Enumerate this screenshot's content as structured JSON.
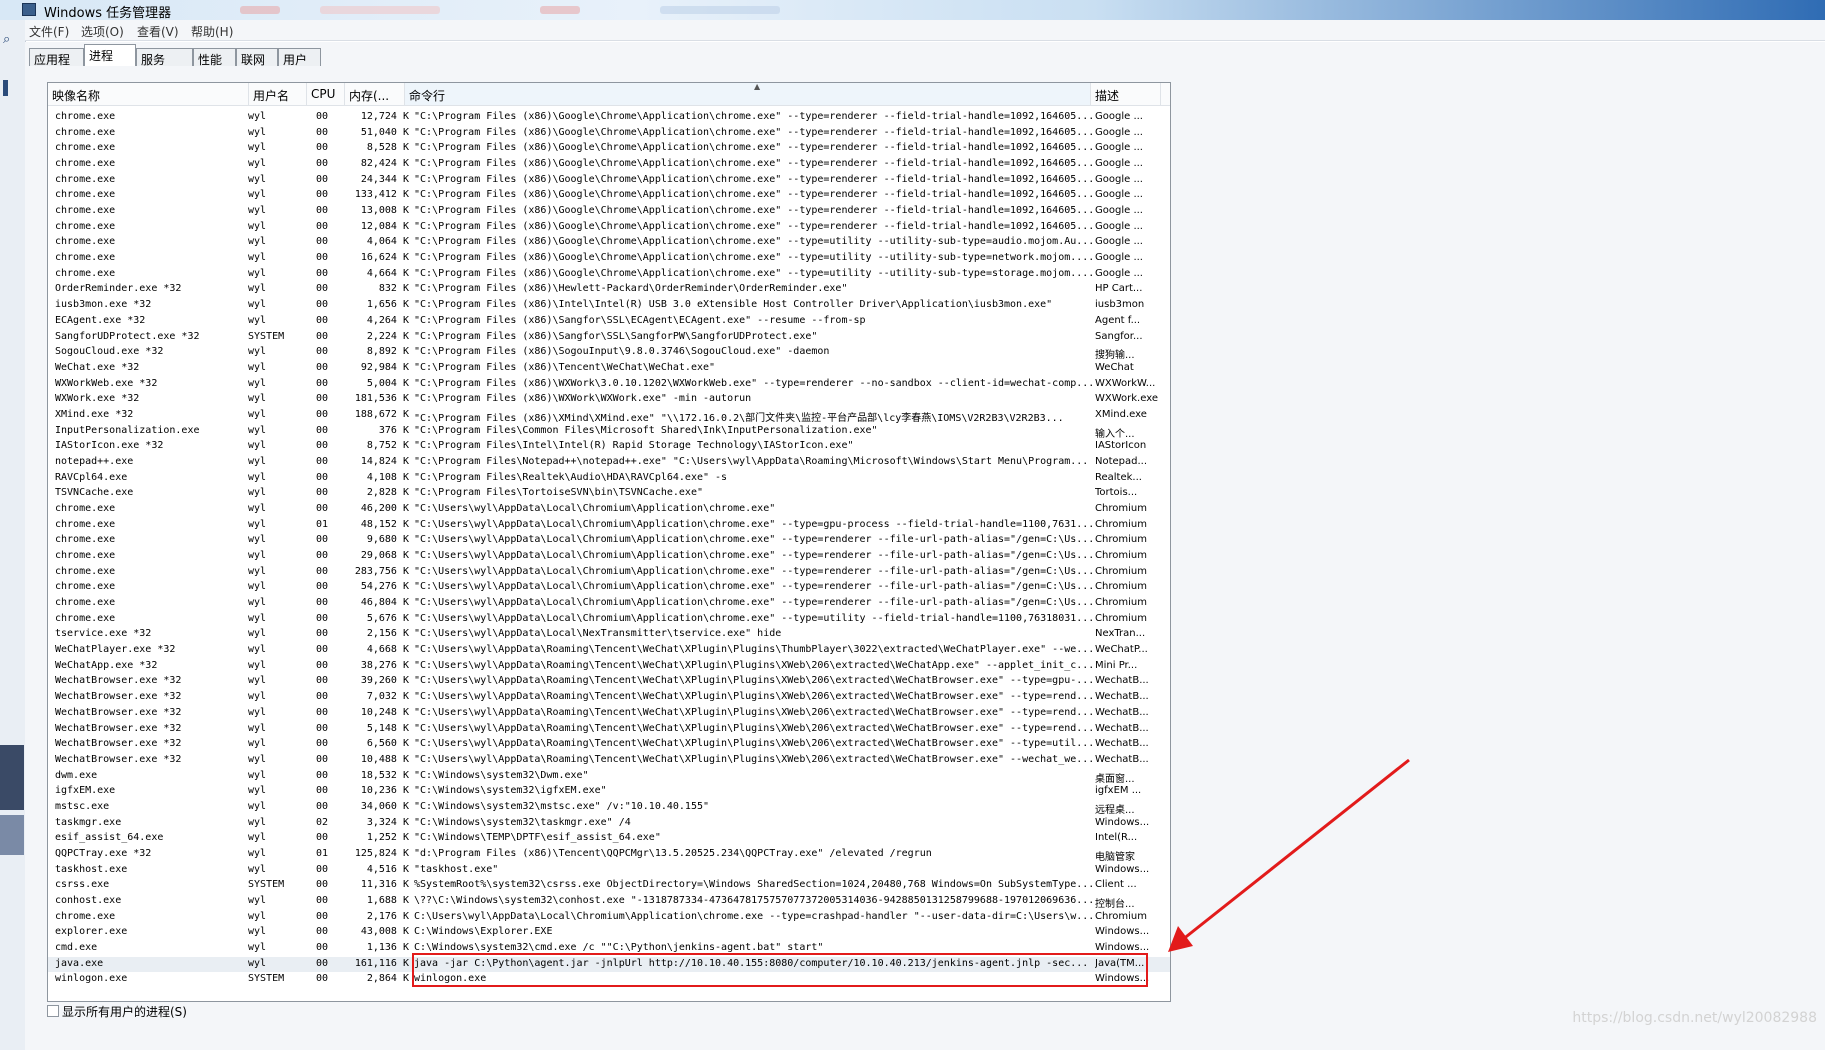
{
  "window": {
    "title": "Windows 任务管理器"
  },
  "menu": [
    {
      "label": "文件(F)"
    },
    {
      "label": "选项(O)"
    },
    {
      "label": "查看(V)"
    },
    {
      "label": "帮助(H)"
    }
  ],
  "tabs": [
    {
      "label": "应用程序"
    },
    {
      "label": "进程"
    },
    {
      "label": "服务"
    },
    {
      "label": "性能"
    },
    {
      "label": "联网"
    },
    {
      "label": "用户"
    }
  ],
  "active_tab": "进程",
  "columns": {
    "name": "映像名称",
    "user": "用户名",
    "cpu": "CPU",
    "mem": "内存(...",
    "cmd": "命令行",
    "desc": "描述"
  },
  "rows": [
    [
      "chrome.exe",
      "wyl",
      "00",
      "12,724 K",
      "\"C:\\Program Files (x86)\\Google\\Chrome\\Application\\chrome.exe\" --type=renderer --field-trial-handle=1092,164605...",
      "Google ..."
    ],
    [
      "chrome.exe",
      "wyl",
      "00",
      "51,040 K",
      "\"C:\\Program Files (x86)\\Google\\Chrome\\Application\\chrome.exe\" --type=renderer --field-trial-handle=1092,164605...",
      "Google ..."
    ],
    [
      "chrome.exe",
      "wyl",
      "00",
      "8,528 K",
      "\"C:\\Program Files (x86)\\Google\\Chrome\\Application\\chrome.exe\" --type=renderer --field-trial-handle=1092,164605...",
      "Google ..."
    ],
    [
      "chrome.exe",
      "wyl",
      "00",
      "82,424 K",
      "\"C:\\Program Files (x86)\\Google\\Chrome\\Application\\chrome.exe\" --type=renderer --field-trial-handle=1092,164605...",
      "Google ..."
    ],
    [
      "chrome.exe",
      "wyl",
      "00",
      "24,344 K",
      "\"C:\\Program Files (x86)\\Google\\Chrome\\Application\\chrome.exe\" --type=renderer --field-trial-handle=1092,164605...",
      "Google ..."
    ],
    [
      "chrome.exe",
      "wyl",
      "00",
      "133,412 K",
      "\"C:\\Program Files (x86)\\Google\\Chrome\\Application\\chrome.exe\" --type=renderer --field-trial-handle=1092,164605...",
      "Google ..."
    ],
    [
      "chrome.exe",
      "wyl",
      "00",
      "13,008 K",
      "\"C:\\Program Files (x86)\\Google\\Chrome\\Application\\chrome.exe\" --type=renderer --field-trial-handle=1092,164605...",
      "Google ..."
    ],
    [
      "chrome.exe",
      "wyl",
      "00",
      "12,084 K",
      "\"C:\\Program Files (x86)\\Google\\Chrome\\Application\\chrome.exe\" --type=renderer --field-trial-handle=1092,164605...",
      "Google ..."
    ],
    [
      "chrome.exe",
      "wyl",
      "00",
      "4,064 K",
      "\"C:\\Program Files (x86)\\Google\\Chrome\\Application\\chrome.exe\" --type=utility --utility-sub-type=audio.mojom.Au...",
      "Google ..."
    ],
    [
      "chrome.exe",
      "wyl",
      "00",
      "16,624 K",
      "\"C:\\Program Files (x86)\\Google\\Chrome\\Application\\chrome.exe\" --type=utility --utility-sub-type=network.mojom....",
      "Google ..."
    ],
    [
      "chrome.exe",
      "wyl",
      "00",
      "4,664 K",
      "\"C:\\Program Files (x86)\\Google\\Chrome\\Application\\chrome.exe\" --type=utility --utility-sub-type=storage.mojom....",
      "Google ..."
    ],
    [
      "OrderReminder.exe *32",
      "wyl",
      "00",
      "832 K",
      "\"C:\\Program Files (x86)\\Hewlett-Packard\\OrderReminder\\OrderReminder.exe\"",
      "HP Cart..."
    ],
    [
      "iusb3mon.exe *32",
      "wyl",
      "00",
      "1,656 K",
      "\"C:\\Program Files (x86)\\Intel\\Intel(R) USB 3.0 eXtensible Host Controller Driver\\Application\\iusb3mon.exe\"",
      "iusb3mon"
    ],
    [
      "ECAgent.exe *32",
      "wyl",
      "00",
      "4,264 K",
      "\"C:\\Program Files (x86)\\Sangfor\\SSL\\ECAgent\\ECAgent.exe\" --resume --from-sp",
      "Agent f..."
    ],
    [
      "SangforUDProtect.exe *32",
      "SYSTEM",
      "00",
      "2,224 K",
      "\"C:\\Program Files (x86)\\Sangfor\\SSL\\SangforPW\\SangforUDProtect.exe\"",
      "Sangfor..."
    ],
    [
      "SogouCloud.exe *32",
      "wyl",
      "00",
      "8,892 K",
      "\"C:\\Program Files (x86)\\SogouInput\\9.8.0.3746\\SogouCloud.exe\" -daemon",
      "搜狗输..."
    ],
    [
      "WeChat.exe *32",
      "wyl",
      "00",
      "92,984 K",
      "\"C:\\Program Files (x86)\\Tencent\\WeChat\\WeChat.exe\"",
      "WeChat"
    ],
    [
      "WXWorkWeb.exe *32",
      "wyl",
      "00",
      "5,004 K",
      "\"C:\\Program Files (x86)\\WXWork\\3.0.10.1202\\WXWorkWeb.exe\" --type=renderer --no-sandbox --client-id=wechat-comp...",
      "WXWorkW..."
    ],
    [
      "WXWork.exe *32",
      "wyl",
      "00",
      "181,536 K",
      "\"C:\\Program Files (x86)\\WXWork\\WXWork.exe\" -min -autorun",
      "WXWork.exe"
    ],
    [
      "XMind.exe *32",
      "wyl",
      "00",
      "188,672 K",
      "\"C:\\Program Files (x86)\\XMind\\XMind.exe\" \"\\\\172.16.0.2\\部门文件夹\\监控-平台产品部\\lcy李春燕\\IOMS\\V2R2B3\\V2R2B3...",
      "XMind.exe"
    ],
    [
      "InputPersonalization.exe",
      "wyl",
      "00",
      "376 K",
      "\"C:\\Program Files\\Common Files\\Microsoft Shared\\Ink\\InputPersonalization.exe\"",
      "输入个..."
    ],
    [
      "IAStorIcon.exe *32",
      "wyl",
      "00",
      "8,752 K",
      "\"C:\\Program Files\\Intel\\Intel(R) Rapid Storage Technology\\IAStorIcon.exe\"",
      "IAStorIcon"
    ],
    [
      "notepad++.exe",
      "wyl",
      "00",
      "14,824 K",
      "\"C:\\Program Files\\Notepad++\\notepad++.exe\"  \"C:\\Users\\wyl\\AppData\\Roaming\\Microsoft\\Windows\\Start Menu\\Program...",
      "Notepad..."
    ],
    [
      "RAVCpl64.exe",
      "wyl",
      "00",
      "4,108 K",
      "\"C:\\Program Files\\Realtek\\Audio\\HDA\\RAVCpl64.exe\" -s",
      "Realtek..."
    ],
    [
      "TSVNCache.exe",
      "wyl",
      "00",
      "2,828 K",
      "\"C:\\Program Files\\TortoiseSVN\\bin\\TSVNCache.exe\"",
      "Tortois..."
    ],
    [
      "chrome.exe",
      "wyl",
      "00",
      "46,200 K",
      "\"C:\\Users\\wyl\\AppData\\Local\\Chromium\\Application\\chrome.exe\"",
      "Chromium"
    ],
    [
      "chrome.exe",
      "wyl",
      "01",
      "48,152 K",
      "\"C:\\Users\\wyl\\AppData\\Local\\Chromium\\Application\\chrome.exe\" --type=gpu-process --field-trial-handle=1100,7631...",
      "Chromium"
    ],
    [
      "chrome.exe",
      "wyl",
      "00",
      "9,680 K",
      "\"C:\\Users\\wyl\\AppData\\Local\\Chromium\\Application\\chrome.exe\" --type=renderer --file-url-path-alias=\"/gen=C:\\Us...",
      "Chromium"
    ],
    [
      "chrome.exe",
      "wyl",
      "00",
      "29,068 K",
      "\"C:\\Users\\wyl\\AppData\\Local\\Chromium\\Application\\chrome.exe\" --type=renderer --file-url-path-alias=\"/gen=C:\\Us...",
      "Chromium"
    ],
    [
      "chrome.exe",
      "wyl",
      "00",
      "283,756 K",
      "\"C:\\Users\\wyl\\AppData\\Local\\Chromium\\Application\\chrome.exe\" --type=renderer --file-url-path-alias=\"/gen=C:\\Us...",
      "Chromium"
    ],
    [
      "chrome.exe",
      "wyl",
      "00",
      "54,276 K",
      "\"C:\\Users\\wyl\\AppData\\Local\\Chromium\\Application\\chrome.exe\" --type=renderer --file-url-path-alias=\"/gen=C:\\Us...",
      "Chromium"
    ],
    [
      "chrome.exe",
      "wyl",
      "00",
      "46,804 K",
      "\"C:\\Users\\wyl\\AppData\\Local\\Chromium\\Application\\chrome.exe\" --type=renderer --file-url-path-alias=\"/gen=C:\\Us...",
      "Chromium"
    ],
    [
      "chrome.exe",
      "wyl",
      "00",
      "5,676 K",
      "\"C:\\Users\\wyl\\AppData\\Local\\Chromium\\Application\\chrome.exe\" --type=utility --field-trial-handle=1100,76318031...",
      "Chromium"
    ],
    [
      "tservice.exe *32",
      "wyl",
      "00",
      "2,156 K",
      "\"C:\\Users\\wyl\\AppData\\Local\\NexTransmitter\\tservice.exe\" hide",
      "NexTran..."
    ],
    [
      "WeChatPlayer.exe *32",
      "wyl",
      "00",
      "4,668 K",
      "\"C:\\Users\\wyl\\AppData\\Roaming\\Tencent\\WeChat\\XPlugin\\Plugins\\ThumbPlayer\\3022\\extracted\\WeChatPlayer.exe\" --we...",
      "WeChatP..."
    ],
    [
      "WeChatApp.exe *32",
      "wyl",
      "00",
      "38,276 K",
      "\"C:\\Users\\wyl\\AppData\\Roaming\\Tencent\\WeChat\\XPlugin\\Plugins\\XWeb\\206\\extracted\\WeChatApp.exe\" --applet_init_c...",
      "Mini Pr..."
    ],
    [
      "WechatBrowser.exe *32",
      "wyl",
      "00",
      "39,260 K",
      "\"C:\\Users\\wyl\\AppData\\Roaming\\Tencent\\WeChat\\XPlugin\\Plugins\\XWeb\\206\\extracted\\WeChatBrowser.exe\" --type=gpu-...",
      "WechatB..."
    ],
    [
      "WechatBrowser.exe *32",
      "wyl",
      "00",
      "7,032 K",
      "\"C:\\Users\\wyl\\AppData\\Roaming\\Tencent\\WeChat\\XPlugin\\Plugins\\XWeb\\206\\extracted\\WeChatBrowser.exe\" --type=rend...",
      "WechatB..."
    ],
    [
      "WechatBrowser.exe *32",
      "wyl",
      "00",
      "10,248 K",
      "\"C:\\Users\\wyl\\AppData\\Roaming\\Tencent\\WeChat\\XPlugin\\Plugins\\XWeb\\206\\extracted\\WeChatBrowser.exe\" --type=rend...",
      "WechatB..."
    ],
    [
      "WechatBrowser.exe *32",
      "wyl",
      "00",
      "5,148 K",
      "\"C:\\Users\\wyl\\AppData\\Roaming\\Tencent\\WeChat\\XPlugin\\Plugins\\XWeb\\206\\extracted\\WeChatBrowser.exe\" --type=rend...",
      "WechatB..."
    ],
    [
      "WechatBrowser.exe *32",
      "wyl",
      "00",
      "6,560 K",
      "\"C:\\Users\\wyl\\AppData\\Roaming\\Tencent\\WeChat\\XPlugin\\Plugins\\XWeb\\206\\extracted\\WeChatBrowser.exe\" --type=util...",
      "WechatB..."
    ],
    [
      "WechatBrowser.exe *32",
      "wyl",
      "00",
      "10,488 K",
      "\"C:\\Users\\wyl\\AppData\\Roaming\\Tencent\\WeChat\\XPlugin\\Plugins\\XWeb\\206\\extracted\\WeChatBrowser.exe\" --wechat_we...",
      "WechatB..."
    ],
    [
      "dwm.exe",
      "wyl",
      "00",
      "18,532 K",
      "\"C:\\Windows\\system32\\Dwm.exe\"",
      "桌面窗..."
    ],
    [
      "igfxEM.exe",
      "wyl",
      "00",
      "10,236 K",
      "\"C:\\Windows\\system32\\igfxEM.exe\"",
      "igfxEM ..."
    ],
    [
      "mstsc.exe",
      "wyl",
      "00",
      "34,060 K",
      "\"C:\\Windows\\system32\\mstsc.exe\" /v:\"10.10.40.155\"",
      "远程桌..."
    ],
    [
      "taskmgr.exe",
      "wyl",
      "02",
      "3,324 K",
      "\"C:\\Windows\\system32\\taskmgr.exe\" /4",
      "Windows..."
    ],
    [
      "esif_assist_64.exe",
      "wyl",
      "00",
      "1,252 K",
      "\"C:\\Windows\\TEMP\\DPTF\\esif_assist_64.exe\"",
      "Intel(R..."
    ],
    [
      "QQPCTray.exe *32",
      "wyl",
      "01",
      "125,824 K",
      "\"d:\\Program Files (x86)\\Tencent\\QQPCMgr\\13.5.20525.234\\QQPCTray.exe\" /elevated /regrun",
      "电脑管家"
    ],
    [
      "taskhost.exe",
      "wyl",
      "00",
      "4,516 K",
      "\"taskhost.exe\"",
      "Windows..."
    ],
    [
      "csrss.exe",
      "SYSTEM",
      "00",
      "11,316 K",
      "%SystemRoot%\\system32\\csrss.exe ObjectDirectory=\\Windows SharedSection=1024,20480,768 Windows=On SubSystemType...",
      "Client ..."
    ],
    [
      "conhost.exe",
      "wyl",
      "00",
      "1,688 K",
      "\\??\\C:\\Windows\\system32\\conhost.exe \"-1318787334-473647817575707737200531403​6-9428850131258799688-197012069636...",
      "控制台..."
    ],
    [
      "chrome.exe",
      "wyl",
      "00",
      "2,176 K",
      "C:\\Users\\wyl\\AppData\\Local\\Chromium\\Application\\chrome.exe --type=crashpad-handler \"--user-data-dir=C:\\Users\\w...",
      "Chromium"
    ],
    [
      "explorer.exe",
      "wyl",
      "00",
      "43,008 K",
      "C:\\Windows\\Explorer.EXE",
      "Windows..."
    ],
    [
      "cmd.exe",
      "wyl",
      "00",
      "1,136 K",
      "C:\\Windows\\system32\\cmd.exe /c \"\"C:\\Python\\jenkins-agent.bat\" start\"",
      "Windows..."
    ],
    [
      "java.exe",
      "wyl",
      "00",
      "161,116 K",
      "java  -jar C:\\Python\\agent.jar -jnlpUrl http://10.10.40.155:8080/computer/10.10.40.213/jenkins-agent.jnlp -sec...",
      "Java(TM..."
    ],
    [
      "winlogon.exe",
      "SYSTEM",
      "00",
      "2,864 K",
      "winlogon.exe",
      "Windows..."
    ]
  ],
  "footer": {
    "show_all_label": "显示所有用户的进程(S)"
  },
  "watermark": "https://blog.csdn.net/wyl20082988",
  "colors": {
    "annotation": "#e21b1b",
    "selected_row": "#e9eef3"
  }
}
